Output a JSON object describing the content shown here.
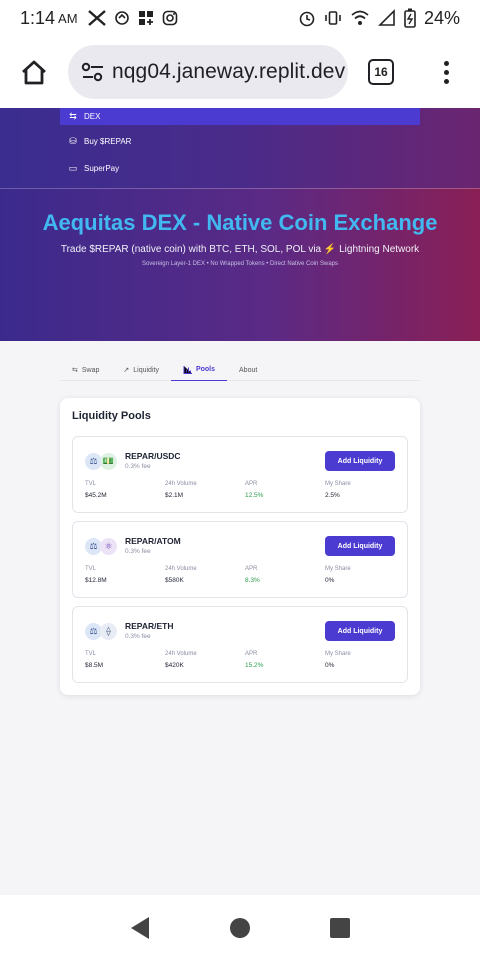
{
  "status_bar": {
    "time": "1:14",
    "ampm": "AM",
    "battery": "24%"
  },
  "browser": {
    "url": "nqg04.janeway.replit.dev",
    "tab_count": "16"
  },
  "nav": {
    "items": [
      {
        "label": "DEX",
        "icon": "swap-arrows-icon"
      },
      {
        "label": "Buy $REPAR",
        "icon": "coins-icon"
      },
      {
        "label": "SuperPay",
        "icon": "card-icon"
      }
    ]
  },
  "hero": {
    "title": "Aequitas DEX - Native Coin Exchange",
    "subtitle": "Trade $REPAR (native coin) with BTC, ETH, SOL, POL via ⚡ Lightning Network",
    "tagline": "Sovereign Layer-1 DEX • No Wrapped Tokens • Direct Native Coin Swaps"
  },
  "tabs": [
    {
      "label": "Swap",
      "icon": "swap-icon"
    },
    {
      "label": "Liquidity",
      "icon": "trend-icon"
    },
    {
      "label": "Pools",
      "icon": "bar-chart-icon",
      "active": true
    },
    {
      "label": "About",
      "icon": ""
    }
  ],
  "pools_card": {
    "title": "Liquidity Pools",
    "stat_labels": {
      "tvl": "TVL",
      "volume": "24h Volume",
      "apr": "APR",
      "share": "My Share"
    },
    "add_label": "Add Liquidity",
    "pools": [
      {
        "pair": "REPAR/USDC",
        "fee": "0.3% fee",
        "tvl": "$45.2M",
        "volume": "$2.1M",
        "apr": "12.5%",
        "share": "2.5%",
        "coin_b": "💵"
      },
      {
        "pair": "REPAR/ATOM",
        "fee": "0.3% fee",
        "tvl": "$12.8M",
        "volume": "$580K",
        "apr": "8.3%",
        "share": "0%",
        "coin_b": "⚛"
      },
      {
        "pair": "REPAR/ETH",
        "fee": "0.3% fee",
        "tvl": "$8.5M",
        "volume": "$420K",
        "apr": "15.2%",
        "share": "0%",
        "coin_b": "⟠"
      }
    ]
  },
  "colors": {
    "accent": "#4b3bd0",
    "title_blue": "#42b8f0",
    "apr_green": "#2a9d4b"
  }
}
